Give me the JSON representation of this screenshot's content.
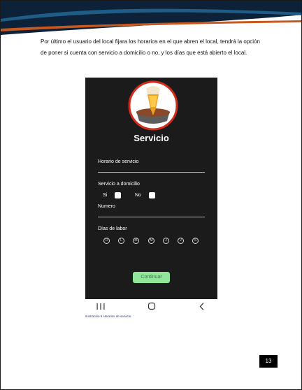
{
  "document": {
    "intro_text": "Por último el usuario del local fijara los horarios en el que abren el local, tendrá la opción de poner si cuenta con servicio a domicilio o no, y los días que está abierto el local.",
    "caption": "Ilustración 6 Horarios de servicio.",
    "page_number": "13"
  },
  "app": {
    "title": "Servicio",
    "horario_label": "Horario de servicio",
    "domicilio_label": "Servicio a domicilio",
    "si_label": "Si",
    "no_label": "No",
    "numero_label": "Numero",
    "dias_label": "Días de labor",
    "days": [
      "D",
      "L",
      "M",
      "M",
      "J",
      "V",
      "S"
    ],
    "continue_label": "Continuar"
  },
  "colors": {
    "header_dark": "#0d2238",
    "header_accent": "#c8581e",
    "app_background": "#1b1b1b",
    "logo_ring": "#d42a1c",
    "continue_button": "#8fe59a"
  },
  "icons": [
    "recent-apps-icon",
    "home-icon",
    "back-icon",
    "beer-pin-logo-icon"
  ]
}
